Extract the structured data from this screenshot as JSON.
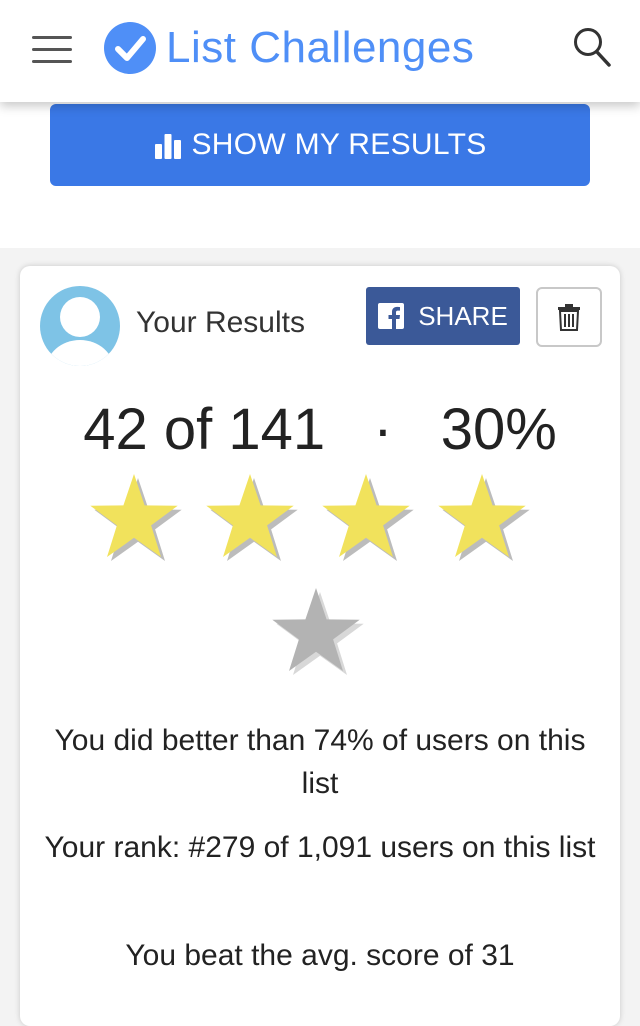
{
  "header": {
    "title": "List Challenges",
    "menu_icon": "hamburger-menu-icon",
    "search_icon": "search-icon",
    "logo_icon": "check-circle-icon",
    "brand_color": "#4f8ff7"
  },
  "action": {
    "show_results_label": "SHOW MY RESULTS",
    "icon": "bar-chart-icon",
    "color": "#3a78e6"
  },
  "results": {
    "heading": "Your Results",
    "share_label": "SHARE",
    "share_color": "#3b5998",
    "delete_icon": "trash-icon",
    "checked": "42",
    "of_word": "of",
    "total": "141",
    "separator": "·",
    "percent": "30%",
    "stars": {
      "filled": 4,
      "total": 5,
      "filled_color": "#f1e25c",
      "empty_color": "#b3b3b3"
    },
    "messages": [
      "You did better than 74% of users on this list",
      "Your rank: #279 of 1,091 users on this list",
      "You beat the avg. score of 31"
    ]
  }
}
